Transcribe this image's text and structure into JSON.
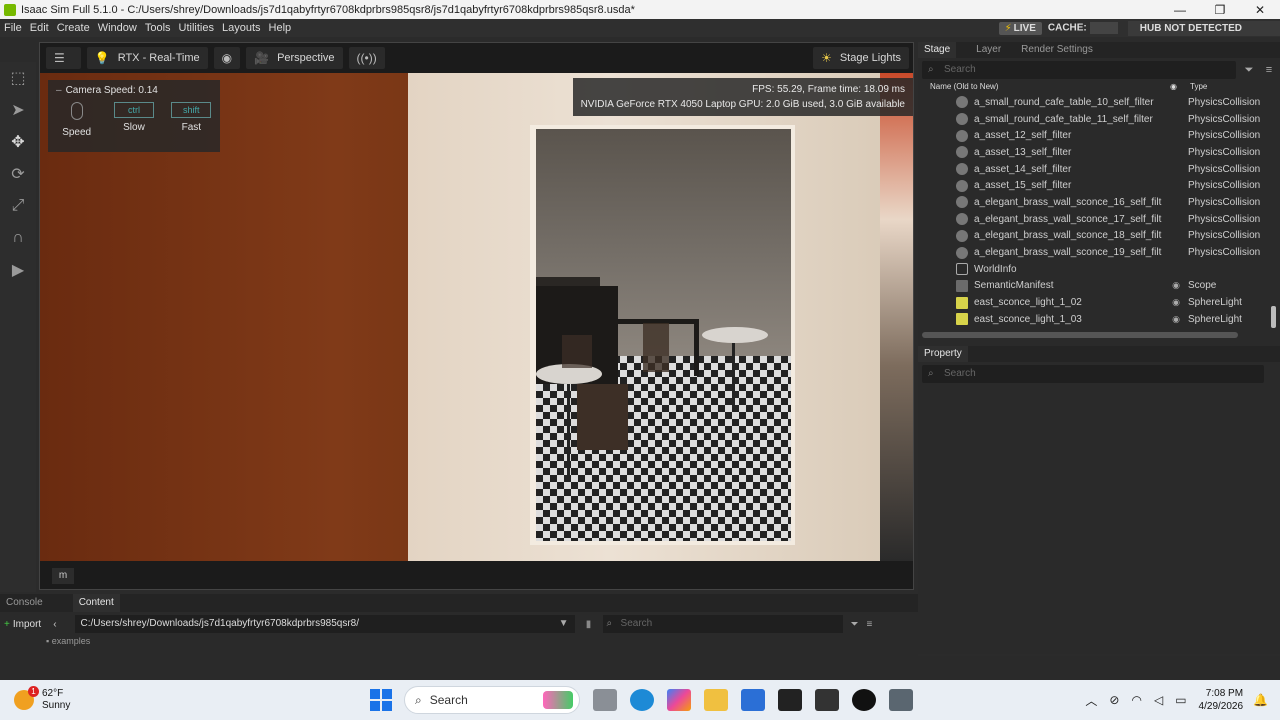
{
  "window": {
    "title": "Isaac Sim Full 5.1.0 - C:/Users/shrey/Downloads/js7d1qabyfrtyr6708kdprbrs985qsr8/js7d1qabyfrtyr6708kdprbrs985qsr8.usda*",
    "minimize": "—",
    "maximize": "❐",
    "close": "✕"
  },
  "menu": [
    "File",
    "Edit",
    "Create",
    "Window",
    "Tools",
    "Utilities",
    "Layouts",
    "Help"
  ],
  "status": {
    "live": "LIVE",
    "cache": "CACHE:",
    "hub": "HUB NOT DETECTED"
  },
  "viewport_toolbar": {
    "render_mode": "RTX - Real-Time",
    "camera": "Perspective",
    "stage_lights": "Stage Lights"
  },
  "perf": {
    "line1": "FPS: 55.29, Frame time: 18.09 ms",
    "line2": "NVIDIA GeForce RTX 4050 Laptop GPU: 2.0 GiB used, 3.0 GiB available"
  },
  "camera_speed": {
    "title": "Camera Speed: 0.14",
    "keys": [
      {
        "key": "",
        "label": "Speed"
      },
      {
        "key": "ctrl",
        "label": "Slow"
      },
      {
        "key": "shift",
        "label": "Fast"
      }
    ]
  },
  "viewport_bottom": {
    "m_label": "m"
  },
  "stage_panel": {
    "tabs": [
      "Stage",
      "Layer",
      "Render Settings"
    ],
    "search_placeholder": "Search",
    "col_name": "Name (Old to New)",
    "col_type": "Type",
    "rows": [
      {
        "name": "a_small_round_cafe_table_10_self_filter",
        "type": "PhysicsCollision",
        "icon": "sphere",
        "eye": ""
      },
      {
        "name": "a_small_round_cafe_table_11_self_filter",
        "type": "PhysicsCollision",
        "icon": "sphere",
        "eye": ""
      },
      {
        "name": "a_asset_12_self_filter",
        "type": "PhysicsCollision",
        "icon": "sphere",
        "eye": ""
      },
      {
        "name": "a_asset_13_self_filter",
        "type": "PhysicsCollision",
        "icon": "sphere",
        "eye": ""
      },
      {
        "name": "a_asset_14_self_filter",
        "type": "PhysicsCollision",
        "icon": "sphere",
        "eye": ""
      },
      {
        "name": "a_asset_15_self_filter",
        "type": "PhysicsCollision",
        "icon": "sphere",
        "eye": ""
      },
      {
        "name": "a_elegant_brass_wall_sconce_16_self_filt",
        "type": "PhysicsCollision",
        "icon": "sphere",
        "eye": ""
      },
      {
        "name": "a_elegant_brass_wall_sconce_17_self_filt",
        "type": "PhysicsCollision",
        "icon": "sphere",
        "eye": ""
      },
      {
        "name": "a_elegant_brass_wall_sconce_18_self_filt",
        "type": "PhysicsCollision",
        "icon": "sphere",
        "eye": ""
      },
      {
        "name": "a_elegant_brass_wall_sconce_19_self_filt",
        "type": "PhysicsCollision",
        "icon": "sphere",
        "eye": ""
      },
      {
        "name": "WorldInfo",
        "type": "",
        "icon": "world",
        "eye": ""
      },
      {
        "name": "SemanticManifest",
        "type": "Scope",
        "icon": "folder",
        "eye": "◉"
      },
      {
        "name": "east_sconce_light_1_02",
        "type": "SphereLight",
        "icon": "light",
        "eye": "◉"
      },
      {
        "name": "east_sconce_light_1_03",
        "type": "SphereLight",
        "icon": "light",
        "eye": "◉"
      }
    ]
  },
  "property_panel": {
    "tab": "Property",
    "search_placeholder": "Search"
  },
  "bottom_panel": {
    "tabs": [
      "Console",
      "Content"
    ],
    "import_label": "Import",
    "path": "C:/Users/shrey/Downloads/js7d1qabyfrtyr6708kdprbrs985qsr8/",
    "search_placeholder": "Search",
    "folder": "examples"
  },
  "taskbar": {
    "temp": "62°F",
    "weather": "Sunny",
    "notif_count": "1",
    "search": "Search",
    "time": "7:08 PM",
    "date": "4/29/2026"
  }
}
